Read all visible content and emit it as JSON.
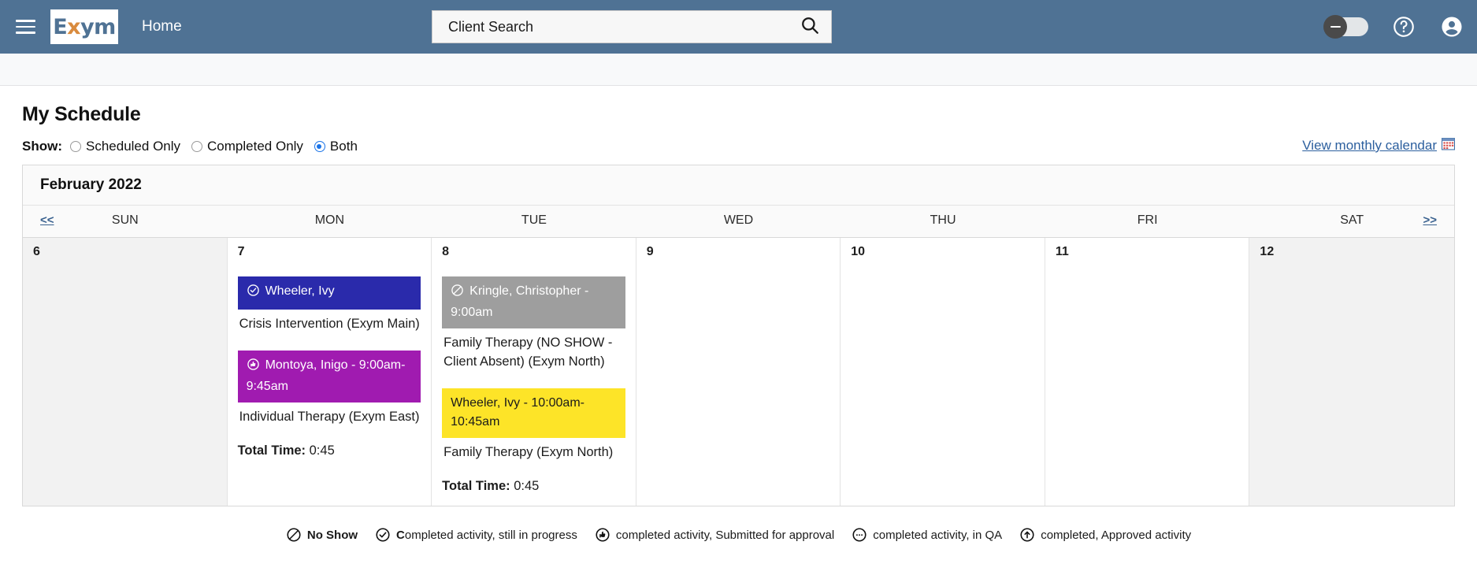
{
  "header": {
    "menu_icon": "hamburger-icon",
    "logo_prefix": "E",
    "logo_x": "x",
    "logo_suffix": "ym",
    "logo_alt": "Exym",
    "home_label": "Home",
    "search_value": "Client Search",
    "search_placeholder": "Client Search",
    "search_icon": "search-icon",
    "toggle_icon": "toggle-switch",
    "help_icon": "help-circle-icon",
    "account_icon": "account-circle-icon",
    "bar_color": "#4f7294"
  },
  "page": {
    "title": "My Schedule",
    "show_label": "Show:",
    "radios": [
      {
        "label": "Scheduled Only",
        "selected": false
      },
      {
        "label": "Completed Only",
        "selected": false
      },
      {
        "label": "Both",
        "selected": true
      }
    ],
    "monthly_link": "View monthly calendar",
    "monthly_link_icon": "calendar-icon",
    "link_color": "#2c5f9e"
  },
  "calendar": {
    "month_label": "February 2022",
    "prev_label": "<<",
    "next_label": ">>",
    "day_headers": [
      "SUN",
      "MON",
      "TUE",
      "WED",
      "THU",
      "FRI",
      "SAT"
    ],
    "days": [
      {
        "number": "6",
        "weekend": true,
        "events": [],
        "total_label": "",
        "total_value": ""
      },
      {
        "number": "7",
        "weekend": false,
        "events": [
          {
            "chip_text": "Wheeler, Ivy",
            "chip_color": "#2a2aab",
            "chip_style": "blue",
            "status_icon": "check-circle-icon",
            "description": "Crisis Intervention (Exym Main)"
          },
          {
            "chip_text": "Montoya, Inigo - 9:00am-9:45am",
            "chip_color": "#a01bb0",
            "chip_style": "purple",
            "status_icon": "thumbs-up-circle-icon",
            "description": "Individual Therapy (Exym East)"
          }
        ],
        "total_label": "Total Time:",
        "total_value": "0:45"
      },
      {
        "number": "8",
        "weekend": false,
        "events": [
          {
            "chip_text": "Kringle, Christopher - 9:00am",
            "chip_color": "#9e9e9e",
            "chip_style": "gray",
            "status_icon": "no-show-icon",
            "description": "Family Therapy (NO SHOW - Client Absent) (Exym North)"
          },
          {
            "chip_text": "Wheeler, Ivy - 10:00am-10:45am",
            "chip_color": "#fde428",
            "chip_style": "yellow",
            "status_icon": "none",
            "description": "Family Therapy (Exym North)"
          }
        ],
        "total_label": "Total Time:",
        "total_value": "0:45"
      },
      {
        "number": "9",
        "weekend": false,
        "events": [],
        "total_label": "",
        "total_value": ""
      },
      {
        "number": "10",
        "weekend": false,
        "events": [],
        "total_label": "",
        "total_value": ""
      },
      {
        "number": "11",
        "weekend": false,
        "events": [],
        "total_label": "",
        "total_value": ""
      },
      {
        "number": "12",
        "weekend": true,
        "events": [],
        "total_label": "",
        "total_value": ""
      }
    ]
  },
  "legend": [
    {
      "icon": "no-show-icon",
      "text_bold": "No Show",
      "text_rest": ""
    },
    {
      "icon": "check-circle-icon",
      "text_bold": "C",
      "text_rest": "ompleted activity, still in progress"
    },
    {
      "icon": "thumbs-up-circle-icon",
      "text_bold": "",
      "text_rest": "completed activity, Submitted for approval"
    },
    {
      "icon": "dots-circle-icon",
      "text_bold": "",
      "text_rest": "completed activity, in QA"
    },
    {
      "icon": "arrow-up-circle-icon",
      "text_bold": "",
      "text_rest": "completed, Approved activity"
    }
  ]
}
